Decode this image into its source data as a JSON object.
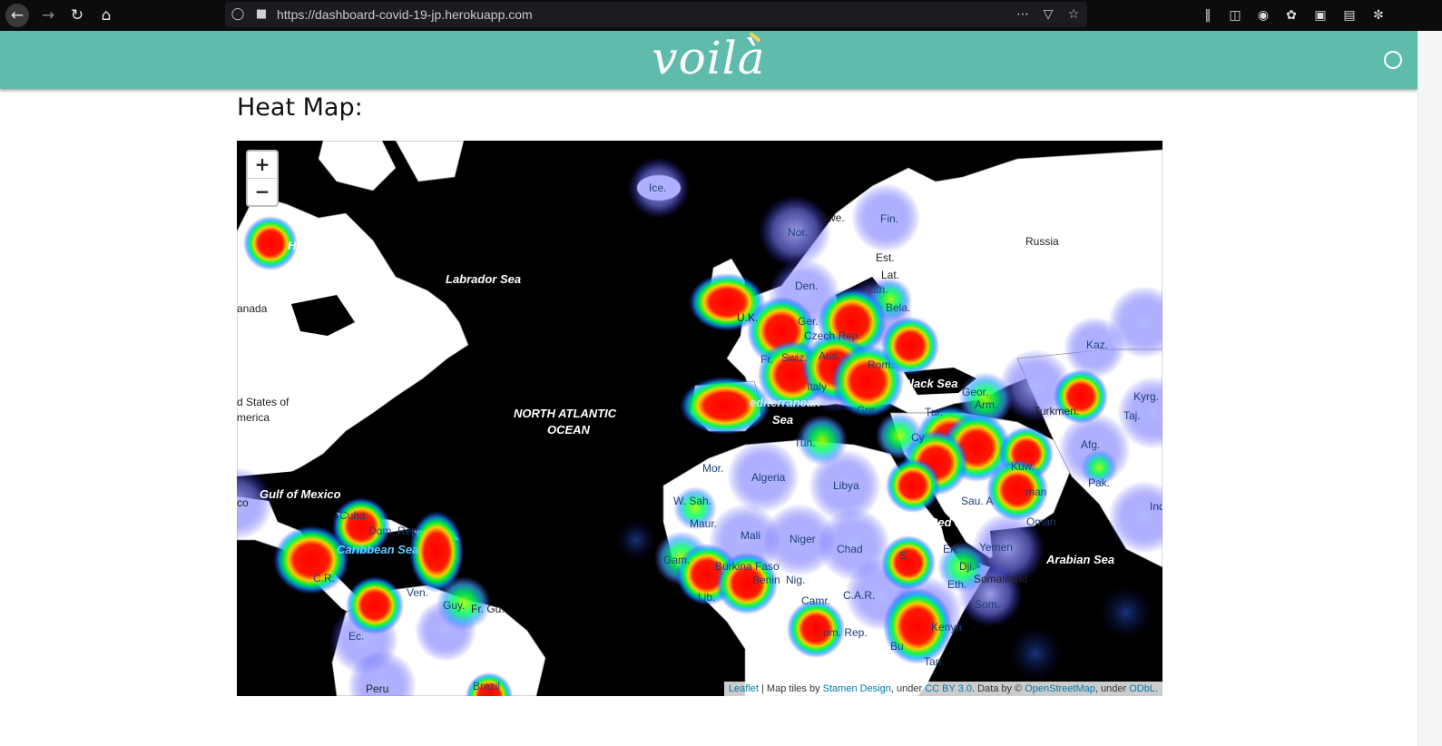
{
  "browser": {
    "url": "https://dashboard-covid-19-jp.herokuapp.com",
    "back_icon": "arrow-left-icon",
    "forward_icon": "arrow-right-icon",
    "reload_icon": "reload-icon",
    "home_icon": "home-icon",
    "toolbar_icons": [
      "library-icon",
      "sidebar-icon",
      "account-icon",
      "extension-icon",
      "reader-icon",
      "bookmarks-icon",
      "cookie-icon"
    ]
  },
  "header": {
    "logo_text": "voilà",
    "brand_color": "#5fbcad"
  },
  "main": {
    "heading": "Heat Map:"
  },
  "map": {
    "zoom_in": "+",
    "zoom_out": "−",
    "labels": {
      "hudson_bay": "Hudson Bay",
      "labrador_sea": "Labrador Sea",
      "canada": "anada",
      "us_line1": "d States of",
      "us_line2": "merica",
      "gulf_mexico": "Gulf of Mexico",
      "caribbean": "Caribbean Sea",
      "north_atlantic_1": "NORTH ATLANTIC",
      "north_atlantic_2": "OCEAN",
      "mediterranean_1": "editerranean",
      "mediterranean_2": "Sea",
      "black_sea": "Black Sea",
      "red_sea": "Red Sea",
      "arabian_sea": "Arabian Sea",
      "iceland": "Ice.",
      "russia": "Russia",
      "swe": "Swe.",
      "fin": "Fin.",
      "nor": "Nor.",
      "est": "Est.",
      "lat": "Lat.",
      "lith": "Lith.",
      "den": "Den.",
      "uk": "U.K.",
      "bela": "Bela.",
      "ger": "Ger.",
      "czech": "Czech Rep.",
      "fr": "Fr.",
      "swiz": "Swiz.",
      "aus": "Aus.",
      "italy": "Italy",
      "rom": "Rom.",
      "gre": "Gre.",
      "tun": "Tun.",
      "tur": "Tur.",
      "geor": "Geor.",
      "arm": "Arm.",
      "kaz": "Kaz.",
      "kyrg": "Kyrg.",
      "turkmen": "Turkmen.",
      "taj": "Taj.",
      "afg": "Afg.",
      "pak": "Pak.",
      "ind": "Ind",
      "cy": "Cy",
      "kuw": "Kuw.",
      "sau": "Sau. A",
      "oman": "Oman",
      "uae": "man",
      "mor": "Mor.",
      "algeria": "Algeria",
      "libya": "Libya",
      "wsah": "W. Sah.",
      "maur": "Maur.",
      "mali": "Mali",
      "niger": "Niger",
      "chad": "Chad",
      "sudan": "S",
      "eri": "Eri.",
      "yemen": "Yemen",
      "dji": "Dji.",
      "somaliland": "Somaliland",
      "eth": "Eth.",
      "som": "Som.",
      "gam": "Gam.",
      "burkina": "Burkina Faso",
      "benin": "Benin",
      "nig": "Nig.",
      "lib": "Lib.",
      "cam": "Camr.",
      "car": "C.A.R.",
      "congo": "om. Rep.",
      "kenya": "Kenya",
      "tan": "Tan.",
      "bu": "Bu",
      "cuba": "Cuba",
      "dom": "Dom. Rep.",
      "ven": "Ven.",
      "guy": "Guy.",
      "frgu": "Fr. Gu.",
      "ec": "Ec.",
      "peru": "Peru",
      "brazil": "Brazil",
      "mexico": "co",
      "cr": "C.R."
    },
    "attribution": {
      "leaflet": "Leaflet",
      "sep": " | Map tiles by ",
      "stamen": "Stamen Design",
      "under1": ", under ",
      "ccby": "CC BY 3.0",
      "data": ". Data by © ",
      "osm": "OpenStreetMap",
      "under2": ", under ",
      "odbl": "ODbL",
      "end": "."
    },
    "hotspot_levels": [
      {
        "region": "hudson-bay",
        "level": "high"
      },
      {
        "region": "uk",
        "level": "high"
      },
      {
        "region": "spain",
        "level": "high"
      },
      {
        "region": "central-europe",
        "level": "high"
      },
      {
        "region": "italy",
        "level": "high"
      },
      {
        "region": "middle-east",
        "level": "high"
      },
      {
        "region": "iran",
        "level": "high"
      },
      {
        "region": "kazakhstan",
        "level": "high"
      },
      {
        "region": "caribbean",
        "level": "high"
      },
      {
        "region": "venezuela",
        "level": "high"
      },
      {
        "region": "colombia",
        "level": "high"
      },
      {
        "region": "west-africa",
        "level": "high"
      },
      {
        "region": "east-africa",
        "level": "high"
      },
      {
        "region": "cameroon",
        "level": "high"
      }
    ],
    "heat_colors": [
      "#0000ff",
      "#00ffff",
      "#00ff00",
      "#ffff00",
      "#ff0000"
    ]
  }
}
